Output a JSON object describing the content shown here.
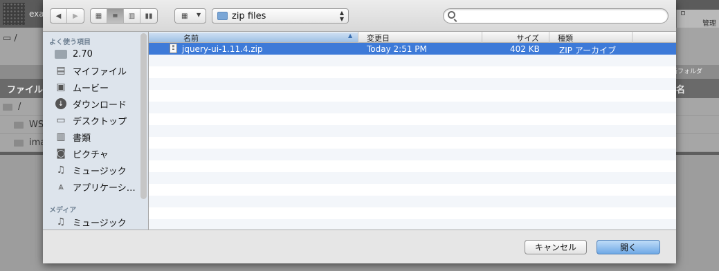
{
  "background": {
    "site_title": "exa",
    "right_label": "管理",
    "path_text": "/",
    "new_folder_label": "新フォルダ",
    "header_left": "ファイル",
    "header_right": "名",
    "rows": [
      {
        "name": "/"
      },
      {
        "name": "WS"
      },
      {
        "name": "ima"
      }
    ]
  },
  "dialog": {
    "toolbar": {
      "path_folder": "zip files",
      "search_placeholder": "",
      "search_value": ""
    },
    "sidebar": {
      "sections": [
        {
          "title": "よく使う項目",
          "items": [
            {
              "label": "2.70",
              "icon": "folder-icon"
            },
            {
              "label": "マイファイル",
              "icon": "all-files-icon"
            },
            {
              "label": "ムービー",
              "icon": "movies-icon"
            },
            {
              "label": "ダウンロード",
              "icon": "downloads-icon"
            },
            {
              "label": "デスクトップ",
              "icon": "desktop-icon"
            },
            {
              "label": "書類",
              "icon": "documents-icon"
            },
            {
              "label": "ピクチャ",
              "icon": "camera-icon"
            },
            {
              "label": "ミュージック",
              "icon": "music-icon"
            },
            {
              "label": "アプリケーシ…",
              "icon": "applications-icon"
            }
          ]
        },
        {
          "title": "メディア",
          "items": [
            {
              "label": "ミュージック",
              "icon": "music-icon"
            }
          ]
        }
      ]
    },
    "columns": {
      "name": "名前",
      "date": "変更日",
      "size": "サイズ",
      "kind": "種類"
    },
    "files": [
      {
        "name": "jquery-ui-1.11.4.zip",
        "date": "Today 2:51 PM",
        "size": "402 KB",
        "kind": "ZIP アーカイブ",
        "selected": true
      }
    ],
    "buttons": {
      "cancel": "キャンセル",
      "open": "開く"
    }
  }
}
